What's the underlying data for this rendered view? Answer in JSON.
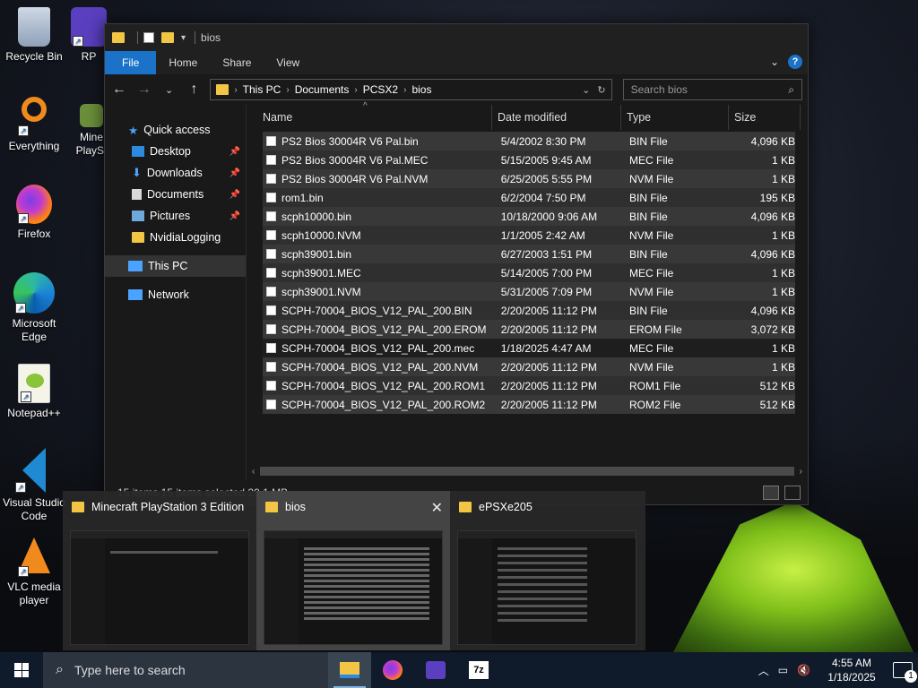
{
  "desktop": {
    "icons": [
      {
        "label": "Recycle Bin"
      },
      {
        "label": "RP"
      },
      {
        "label": "Everything"
      },
      {
        "label": "Mine PlaySt"
      },
      {
        "label": "Firefox"
      },
      {
        "label": "Microsoft Edge"
      },
      {
        "label": "Notepad++"
      },
      {
        "label": "Visual Studio Code"
      },
      {
        "label": "VLC media player"
      }
    ]
  },
  "explorer": {
    "title": "bios",
    "ribbon": {
      "file": "File",
      "home": "Home",
      "share": "Share",
      "view": "View"
    },
    "address": {
      "crumbs": [
        "This PC",
        "Documents",
        "PCSX2",
        "bios"
      ]
    },
    "search_placeholder": "Search bios",
    "nav": {
      "quick_access": "Quick access",
      "items": [
        "Desktop",
        "Downloads",
        "Documents",
        "Pictures",
        "NvidiaLogging"
      ],
      "this_pc": "This PC",
      "network": "Network"
    },
    "columns": {
      "name": "Name",
      "date": "Date modified",
      "type": "Type",
      "size": "Size"
    },
    "files": [
      {
        "name": "PS2 Bios 30004R V6 Pal.bin",
        "date": "5/4/2002 8:30 PM",
        "type": "BIN File",
        "size": "4,096 KB"
      },
      {
        "name": "PS2 Bios 30004R V6 Pal.MEC",
        "date": "5/15/2005 9:45 AM",
        "type": "MEC File",
        "size": "1 KB"
      },
      {
        "name": "PS2 Bios 30004R V6 Pal.NVM",
        "date": "6/25/2005 5:55 PM",
        "type": "NVM File",
        "size": "1 KB"
      },
      {
        "name": "rom1.bin",
        "date": "6/2/2004 7:50 PM",
        "type": "BIN File",
        "size": "195 KB"
      },
      {
        "name": "scph10000.bin",
        "date": "10/18/2000 9:06 AM",
        "type": "BIN File",
        "size": "4,096 KB"
      },
      {
        "name": "scph10000.NVM",
        "date": "1/1/2005 2:42 AM",
        "type": "NVM File",
        "size": "1 KB"
      },
      {
        "name": "scph39001.bin",
        "date": "6/27/2003 1:51 PM",
        "type": "BIN File",
        "size": "4,096 KB"
      },
      {
        "name": "scph39001.MEC",
        "date": "5/14/2005 7:00 PM",
        "type": "MEC File",
        "size": "1 KB"
      },
      {
        "name": "scph39001.NVM",
        "date": "5/31/2005 7:09 PM",
        "type": "NVM File",
        "size": "1 KB"
      },
      {
        "name": "SCPH-70004_BIOS_V12_PAL_200.BIN",
        "date": "2/20/2005 11:12 PM",
        "type": "BIN File",
        "size": "4,096 KB"
      },
      {
        "name": "SCPH-70004_BIOS_V12_PAL_200.EROM",
        "date": "2/20/2005 11:12 PM",
        "type": "EROM File",
        "size": "3,072 KB"
      },
      {
        "name": "SCPH-70004_BIOS_V12_PAL_200.mec",
        "date": "1/18/2025 4:47 AM",
        "type": "MEC File",
        "size": "1 KB"
      },
      {
        "name": "SCPH-70004_BIOS_V12_PAL_200.NVM",
        "date": "2/20/2005 11:12 PM",
        "type": "NVM File",
        "size": "1 KB"
      },
      {
        "name": "SCPH-70004_BIOS_V12_PAL_200.ROM1",
        "date": "2/20/2005 11:12 PM",
        "type": "ROM1 File",
        "size": "512 KB"
      },
      {
        "name": "SCPH-70004_BIOS_V12_PAL_200.ROM2",
        "date": "2/20/2005 11:12 PM",
        "type": "ROM2 File",
        "size": "512 KB"
      }
    ],
    "status": "15 items   15 items selected  20.1 MB"
  },
  "thumbnails": [
    {
      "title": "Minecraft PlayStation 3 Edition"
    },
    {
      "title": "bios"
    },
    {
      "title": "ePSXe205"
    }
  ],
  "taskbar": {
    "search_placeholder": "Type here to search",
    "time": "4:55 AM",
    "date": "1/18/2025",
    "notifications": "1",
    "apps": [
      "file-explorer-icon",
      "firefox-icon",
      "rpcs3-icon",
      "7zip-icon"
    ]
  },
  "colors": {
    "accent": "#1a73c8",
    "tent": "#9ad82a"
  }
}
